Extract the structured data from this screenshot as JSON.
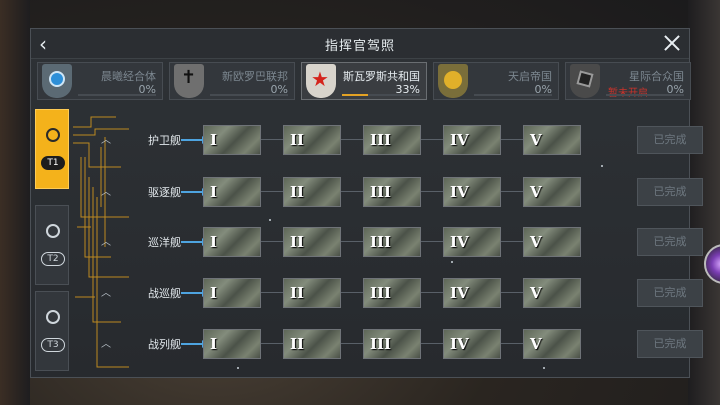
{
  "header": {
    "title": "指挥官驾照",
    "back_icon": "chevron-left-icon",
    "close_icon": "close-icon"
  },
  "tabs": [
    {
      "name": "晨曦经合体",
      "percent": "0%",
      "progress": 0,
      "emblem_color": "#5b6a74",
      "emblem_icon": "circle-wave-icon",
      "active": false
    },
    {
      "name": "新欧罗巴联邦",
      "percent": "0%",
      "progress": 0,
      "emblem_color": "#6f6f6f",
      "emblem_icon": "cross-icon",
      "active": false
    },
    {
      "name": "斯瓦罗斯共和国",
      "percent": "33%",
      "progress": 0.33,
      "emblem_color": "#d8d4cc",
      "emblem_icon": "red-star-icon",
      "active": true
    },
    {
      "name": "天启帝国",
      "percent": "0%",
      "progress": 0,
      "emblem_color": "#7a6e3a",
      "emblem_icon": "circles-icon",
      "active": false
    },
    {
      "name": "星际合众国",
      "percent": "0%",
      "progress": 0,
      "emblem_color": "#4a4a4a",
      "emblem_icon": "hex-icon",
      "active": false,
      "lock_text": "暂未开启"
    }
  ],
  "tiers": [
    {
      "tag": "T1",
      "active": true
    },
    {
      "tag": "T2",
      "active": false
    },
    {
      "tag": "T3",
      "active": false
    }
  ],
  "ship_rows": [
    {
      "label": "护卫舰",
      "status": "已完成"
    },
    {
      "label": "驱逐舰",
      "status": "已完成"
    },
    {
      "label": "巡洋舰",
      "status": "已完成"
    },
    {
      "label": "战巡舰",
      "status": "已完成"
    },
    {
      "label": "战列舰",
      "status": "已完成"
    }
  ],
  "levels": [
    "I",
    "II",
    "III",
    "IV",
    "V"
  ],
  "colors": {
    "accent": "#f4b21b",
    "progress": "#e3a224",
    "arrow": "#4ea4e0",
    "lock": "#c9332b"
  }
}
